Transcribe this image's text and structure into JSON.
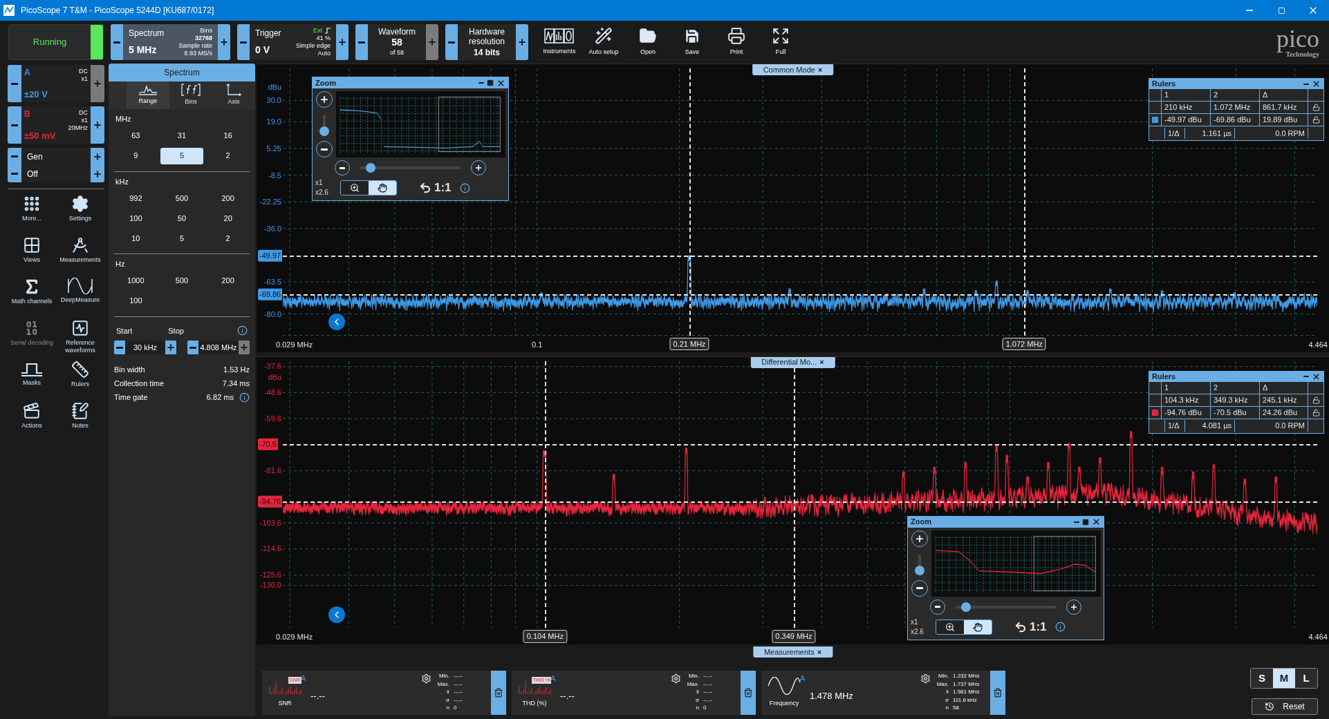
{
  "window": {
    "title": "PicoScope 7 T&M  - PicoScope 5244D [KU687/0172]"
  },
  "toolbar": {
    "run": {
      "label": "Running",
      "running": true
    },
    "spectrum": {
      "title": "Spectrum",
      "value": "5 MHz",
      "bins_label": "Bins",
      "bins": "32768",
      "rate_label": "Sample rate",
      "rate": "8.93 MS/s"
    },
    "trigger": {
      "title": "Trigger",
      "value": "0 V",
      "source": "Ext",
      "threshold": "41 %",
      "type": "Simple edge",
      "mode": "Auto"
    },
    "waveform": {
      "title": "Waveform",
      "value": "58",
      "of": "of 58",
      "plus_disabled": true
    },
    "resolution": {
      "title": "Hardware resolution",
      "value": "14 bits"
    },
    "tools": [
      {
        "label": "Instruments"
      },
      {
        "label": "Auto setup"
      },
      {
        "label": "Open"
      },
      {
        "label": "Save"
      },
      {
        "label": "Print"
      },
      {
        "label": "Full"
      }
    ],
    "logo": {
      "name": "pico",
      "tagline": "Technology"
    }
  },
  "channels": [
    {
      "name": "A",
      "coupling": "DC",
      "probe": "x1",
      "range": "±20 V",
      "color": "#3d9be9",
      "plus_disabled": true
    },
    {
      "name": "B",
      "coupling": "DC",
      "probe": "x1",
      "bandwidth": "20MHz",
      "range": "±50 mV",
      "color": "#e8243c",
      "plus_disabled": false
    }
  ],
  "generator": [
    {
      "label": "Gen"
    },
    {
      "label": "Off"
    }
  ],
  "side_tools": [
    {
      "label": "More...",
      "disabled": false
    },
    {
      "label": "Settings",
      "disabled": false
    },
    {
      "label": "Views",
      "disabled": false
    },
    {
      "label": "Measurements",
      "disabled": false
    },
    {
      "label": "Math channels",
      "disabled": false
    },
    {
      "label": "DeepMeasure",
      "disabled": false
    },
    {
      "label": "Serial decoding",
      "disabled": true
    },
    {
      "label": "Reference waveforms",
      "disabled": false
    },
    {
      "label": "Masks",
      "disabled": false
    },
    {
      "label": "Rulers",
      "disabled": false
    },
    {
      "label": "Actions",
      "disabled": false
    },
    {
      "label": "Notes",
      "disabled": false
    }
  ],
  "spectrum_panel": {
    "title": "Spectrum",
    "tabs": [
      {
        "label": "Range",
        "selected": true
      },
      {
        "label": "Bins",
        "selected": false
      },
      {
        "label": "Axis",
        "selected": false
      }
    ],
    "groups": [
      {
        "unit": "MHz",
        "options": [
          {
            "label": "63",
            "selected": false
          },
          {
            "label": "31",
            "selected": false
          },
          {
            "label": "16",
            "selected": false
          },
          {
            "label": "9",
            "selected": false
          },
          {
            "label": "5",
            "selected": true
          },
          {
            "label": "2",
            "selected": false
          }
        ]
      },
      {
        "unit": "kHz",
        "options": [
          {
            "label": "992",
            "selected": false
          },
          {
            "label": "500",
            "selected": false
          },
          {
            "label": "200",
            "selected": false
          },
          {
            "label": "100",
            "selected": false
          },
          {
            "label": "50",
            "selected": false
          },
          {
            "label": "20",
            "selected": false
          },
          {
            "label": "10",
            "selected": false
          },
          {
            "label": "5",
            "selected": false
          },
          {
            "label": "2",
            "selected": false
          }
        ]
      },
      {
        "unit": "Hz",
        "options": [
          {
            "label": "1000",
            "selected": false
          },
          {
            "label": "500",
            "selected": false
          },
          {
            "label": "200",
            "selected": false
          },
          {
            "label": "100",
            "selected": false
          }
        ]
      }
    ],
    "start": {
      "label": "Start",
      "value": "30 kHz",
      "plus_disabled": false
    },
    "stop": {
      "label": "Stop",
      "value": "4.808 MHz",
      "plus_disabled": true
    },
    "info": [
      {
        "label": "Bin width",
        "value": "1.53 Hz",
        "has_info": false
      },
      {
        "label": "Collection time",
        "value": "7.34 ms",
        "has_info": false
      },
      {
        "label": "Time gate",
        "value": "6.82 ms",
        "has_info": true
      }
    ]
  },
  "views": [
    {
      "tab": "Common Mode",
      "close": "×",
      "color": "#3d9be9",
      "unit": "dBu",
      "y_labels": [
        {
          "text": "30.0",
          "kind": "tick"
        },
        {
          "text": "19.0",
          "kind": "tick"
        },
        {
          "text": "5.25",
          "kind": "tick"
        },
        {
          "text": "-8.5",
          "kind": "tick"
        },
        {
          "text": "-22.25",
          "kind": "tick"
        },
        {
          "text": "-36.0",
          "kind": "tick"
        },
        {
          "text": "-49.97",
          "kind": "ruler"
        },
        {
          "text": "-63.5",
          "kind": "tick"
        },
        {
          "text": "-69.86",
          "kind": "ruler"
        },
        {
          "text": "-80.0",
          "kind": "tick"
        }
      ],
      "x_labels": [
        {
          "text": "0.029 MHz",
          "kind": "tick"
        },
        {
          "text": "0.1",
          "kind": "tick"
        },
        {
          "text": "0.21 MHz",
          "kind": "ruler"
        },
        {
          "text": "1.072 MHz",
          "kind": "ruler"
        },
        {
          "text": "4.464",
          "kind": "tick"
        }
      ],
      "zoom": {
        "title": "Zoom",
        "scale_min": "x1",
        "scale_max": "x2.6",
        "reset": "1:1",
        "vertical_slider": {
          "level": 0.1
        },
        "horizontal_slider": {
          "level": 0.1
        },
        "modes": [
          {
            "kind": "zoom",
            "selected": false
          },
          {
            "kind": "pan",
            "selected": true
          }
        ]
      },
      "rulers": {
        "title": "Rulers",
        "headers": [
          "1",
          "2",
          "Δ"
        ],
        "rows": [
          {
            "values": [
              "210 kHz",
              "1.072 MHz",
              "861.7 kHz"
            ],
            "swatch": false,
            "locked": false
          },
          {
            "values": [
              "-49.97 dBu",
              "-69.86 dBu",
              "19.89 dBu"
            ],
            "swatch": true,
            "locked": false
          }
        ],
        "inverse": {
          "label": "1/Δ",
          "value": "1.161 µs",
          "rpm": "0.0 RPM"
        }
      }
    },
    {
      "tab": "Differential Mo...",
      "close": "×",
      "color": "#e8243c",
      "unit": "dBu",
      "y_labels": [
        {
          "text": "-37.6",
          "kind": "tick"
        },
        {
          "text": "-48.6",
          "kind": "tick"
        },
        {
          "text": "-59.6",
          "kind": "tick"
        },
        {
          "text": "-70.5",
          "kind": "ruler"
        },
        {
          "text": "-81.6",
          "kind": "tick"
        },
        {
          "text": "-94.76",
          "kind": "ruler"
        },
        {
          "text": "-103.6",
          "kind": "tick"
        },
        {
          "text": "-114.6",
          "kind": "tick"
        },
        {
          "text": "-125.6",
          "kind": "tick"
        },
        {
          "text": "-130.0",
          "kind": "tick"
        }
      ],
      "x_labels": [
        {
          "text": "0.029 MHz",
          "kind": "tick"
        },
        {
          "text": "0.104 MHz",
          "kind": "ruler"
        },
        {
          "text": "0.349 MHz",
          "kind": "ruler"
        },
        {
          "text": "4.464",
          "kind": "tick"
        }
      ],
      "zoom": {
        "title": "Zoom",
        "scale_min": "x1",
        "scale_max": "x2.6",
        "reset": "1:1",
        "vertical_slider": {
          "level": 0.1
        },
        "horizontal_slider": {
          "level": 0.1
        },
        "modes": [
          {
            "kind": "zoom",
            "selected": false
          },
          {
            "kind": "pan",
            "selected": true
          }
        ]
      },
      "rulers": {
        "title": "Rulers",
        "headers": [
          "1",
          "2",
          "Δ"
        ],
        "rows": [
          {
            "values": [
              "104.3 kHz",
              "349.3 kHz",
              "245.1 kHz"
            ],
            "swatch": false,
            "locked": false
          },
          {
            "values": [
              "-94.76 dBu",
              "-70.5 dBu",
              "24.26 dBu"
            ],
            "swatch": true,
            "locked": false
          }
        ],
        "inverse": {
          "label": "1/Δ",
          "value": "4.081 µs",
          "rpm": "0.0 RPM"
        }
      }
    }
  ],
  "measurements": {
    "title": "Measurements",
    "close": "×",
    "items": [
      {
        "kind": "snr",
        "thumb_label": "SNR",
        "channel": "A",
        "name": "SNR",
        "value": "--.--",
        "stats": [
          {
            "label": "Min.",
            "value": "--.--"
          },
          {
            "label": "Max.",
            "value": "--.--"
          },
          {
            "label": "x̄",
            "value": "--.--"
          },
          {
            "label": "σ",
            "value": "--.--"
          },
          {
            "label": "n",
            "value": "0"
          }
        ]
      },
      {
        "kind": "thd",
        "thumb_label": "THD %",
        "channel": "A",
        "name": "THD (%)",
        "value": "--.--",
        "stats": [
          {
            "label": "Min.",
            "value": "--.--"
          },
          {
            "label": "Max.",
            "value": "--.--"
          },
          {
            "label": "x̄",
            "value": "--.--"
          },
          {
            "label": "σ",
            "value": "--.--"
          },
          {
            "label": "n",
            "value": "0"
          }
        ]
      },
      {
        "kind": "frequency",
        "channel": "A",
        "name": "Frequency",
        "value": "1.478 MHz",
        "stats": [
          {
            "label": "Min.",
            "value": "1.232 MHz"
          },
          {
            "label": "Max.",
            "value": "1.737 MHz"
          },
          {
            "label": "x̄",
            "value": "1.561 MHz"
          },
          {
            "label": "σ",
            "value": "111.6 kHz"
          },
          {
            "label": "n",
            "value": "58"
          }
        ]
      }
    ]
  },
  "size_buttons": [
    {
      "label": "S",
      "selected": false
    },
    {
      "label": "M",
      "selected": true
    },
    {
      "label": "L",
      "selected": false
    }
  ],
  "reset": "Reset"
}
